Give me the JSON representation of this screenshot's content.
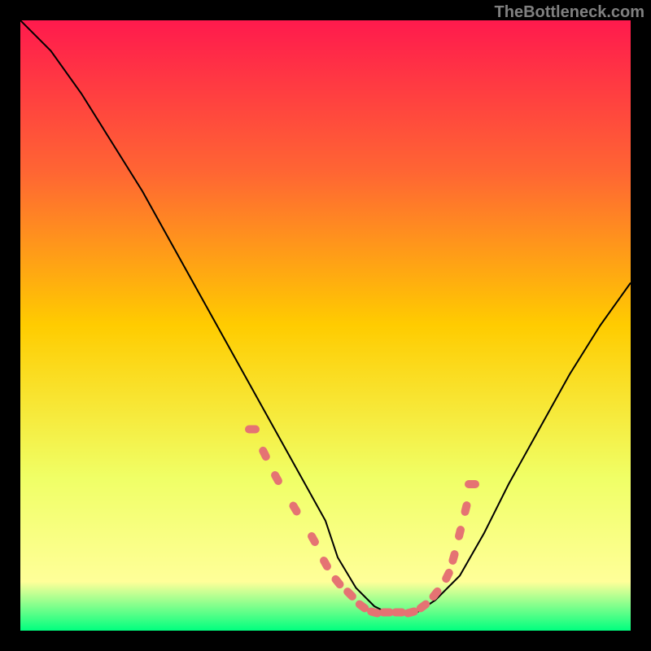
{
  "watermark": "TheBottleneck.com",
  "chart_data": {
    "type": "line",
    "title": "",
    "xlabel": "",
    "ylabel": "",
    "xlim": [
      0,
      100
    ],
    "ylim": [
      0,
      100
    ],
    "background_gradient": {
      "stops": [
        {
          "offset": 0,
          "color": "#ff1a4d"
        },
        {
          "offset": 25,
          "color": "#ff6633"
        },
        {
          "offset": 50,
          "color": "#ffcc00"
        },
        {
          "offset": 75,
          "color": "#f0ff66"
        },
        {
          "offset": 92,
          "color": "#ffff99"
        },
        {
          "offset": 100,
          "color": "#00ff7f"
        }
      ]
    },
    "series": [
      {
        "name": "curve",
        "color": "#000000",
        "x": [
          0,
          5,
          10,
          15,
          20,
          25,
          30,
          35,
          40,
          45,
          50,
          52,
          55,
          58,
          60,
          63,
          65,
          68,
          72,
          76,
          80,
          85,
          90,
          95,
          100
        ],
        "y": [
          100,
          95,
          88,
          80,
          72,
          63,
          54,
          45,
          36,
          27,
          18,
          12,
          7,
          4,
          3,
          3,
          3,
          5,
          9,
          16,
          24,
          33,
          42,
          50,
          57
        ]
      },
      {
        "name": "markers",
        "color": "#e57373",
        "type": "scatter",
        "x": [
          38,
          40,
          42,
          45,
          48,
          50,
          52,
          54,
          56,
          58,
          60,
          62,
          64,
          66,
          68,
          70,
          71,
          72,
          73,
          74
        ],
        "y": [
          33,
          29,
          25,
          20,
          15,
          11,
          8,
          6,
          4,
          3,
          3,
          3,
          3,
          4,
          6,
          9,
          12,
          16,
          20,
          24
        ]
      }
    ]
  }
}
